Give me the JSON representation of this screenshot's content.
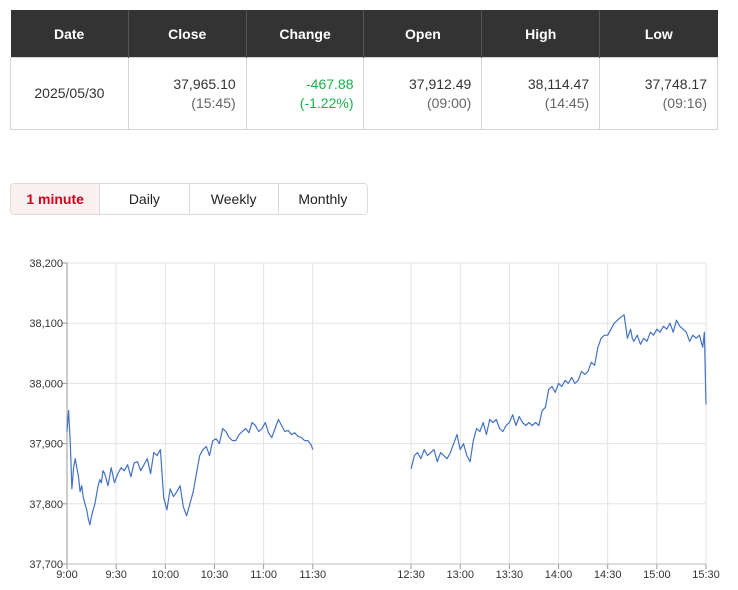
{
  "quote": {
    "headers": {
      "date": "Date",
      "close": "Close",
      "change": "Change",
      "open": "Open",
      "high": "High",
      "low": "Low"
    },
    "date": "2025/05/30",
    "close": {
      "value": "37,965.10",
      "time": "(15:45)"
    },
    "change": {
      "value": "-467.88",
      "percent": "(-1.22%)"
    },
    "open": {
      "value": "37,912.49",
      "time": "(09:00)"
    },
    "high": {
      "value": "38,114.47",
      "time": "(14:45)"
    },
    "low": {
      "value": "37,748.17",
      "time": "(09:16)"
    }
  },
  "tabs": [
    {
      "label": "1 minute",
      "active": true
    },
    {
      "label": "Daily",
      "active": false
    },
    {
      "label": "Weekly",
      "active": false
    },
    {
      "label": "Monthly",
      "active": false
    }
  ],
  "colors": {
    "line": "#4472c4",
    "negative": "#17b24a",
    "active_tab": "#d0021b",
    "header_bg": "#333333"
  },
  "chart_data": {
    "type": "line",
    "title": "",
    "xlabel": "",
    "ylabel": "",
    "grid": true,
    "xlim": [
      "09:00",
      "15:30"
    ],
    "ylim": [
      37700,
      38200
    ],
    "x_ticks": [
      "9:00",
      "9:30",
      "10:00",
      "10:30",
      "11:00",
      "11:30",
      "12:30",
      "13:00",
      "13:30",
      "14:00",
      "14:30",
      "15:00",
      "15:30"
    ],
    "y_ticks": [
      "37,700",
      "37,800",
      "37,900",
      "38,000",
      "38,100",
      "38,200"
    ],
    "series": [
      {
        "segments": [
          {
            "x": [
              "09:00",
              "09:01",
              "09:02",
              "09:03",
              "09:04",
              "09:05",
              "09:06",
              "09:07",
              "09:08",
              "09:09",
              "09:10",
              "09:11",
              "09:12",
              "09:13",
              "09:14",
              "09:15",
              "09:16",
              "09:17",
              "09:18",
              "09:19",
              "09:20",
              "09:21",
              "09:22",
              "09:23",
              "09:25",
              "09:27",
              "09:29",
              "09:31",
              "09:33",
              "09:35",
              "09:37",
              "09:39",
              "09:41",
              "09:43",
              "09:45",
              "09:47",
              "09:49",
              "09:51",
              "09:53",
              "09:55",
              "09:57",
              "09:59",
              "10:01",
              "10:03",
              "10:05",
              "10:07",
              "10:09",
              "10:11",
              "10:13",
              "10:15",
              "10:17",
              "10:19",
              "10:21",
              "10:23",
              "10:25",
              "10:27",
              "10:29",
              "10:31",
              "10:33",
              "10:35",
              "10:37",
              "10:39",
              "10:41",
              "10:43",
              "10:45",
              "10:47",
              "10:49",
              "10:51",
              "10:53",
              "10:55",
              "10:57",
              "10:59",
              "11:01",
              "11:03",
              "11:05",
              "11:07",
              "11:09",
              "11:11",
              "11:13",
              "11:15",
              "11:17",
              "11:19",
              "11:21",
              "11:23",
              "11:25",
              "11:27",
              "11:29",
              "11:30"
            ],
            "y": [
              37920,
              37955,
              37900,
              37825,
              37860,
              37875,
              37860,
              37845,
              37820,
              37830,
              37810,
              37800,
              37790,
              37775,
              37765,
              37780,
              37790,
              37800,
              37815,
              37830,
              37840,
              37835,
              37855,
              37850,
              37830,
              37860,
              37835,
              37850,
              37860,
              37855,
              37865,
              37845,
              37868,
              37870,
              37855,
              37865,
              37875,
              37850,
              37885,
              37880,
              37890,
              37810,
              37790,
              37825,
              37812,
              37820,
              37830,
              37795,
              37780,
              37800,
              37820,
              37850,
              37880,
              37890,
              37895,
              37880,
              37905,
              37908,
              37900,
              37925,
              37920,
              37910,
              37905,
              37905,
              37915,
              37920,
              37925,
              37918,
              37935,
              37930,
              37920,
              37925,
              37935,
              37918,
              37910,
              37925,
              37940,
              37930,
              37920,
              37922,
              37915,
              37918,
              37912,
              37910,
              37905,
              37905,
              37898,
              37890
            ]
          },
          {
            "x": [
              "12:30",
              "12:32",
              "12:34",
              "12:36",
              "12:38",
              "12:40",
              "12:42",
              "12:44",
              "12:46",
              "12:48",
              "12:50",
              "12:52",
              "12:54",
              "12:56",
              "12:58",
              "13:00",
              "13:02",
              "13:04",
              "13:06",
              "13:08",
              "13:10",
              "13:12",
              "13:14",
              "13:16",
              "13:18",
              "13:20",
              "13:22",
              "13:24",
              "13:26",
              "13:28",
              "13:30",
              "13:32",
              "13:34",
              "13:36",
              "13:38",
              "13:40",
              "13:42",
              "13:44",
              "13:46",
              "13:48",
              "13:50",
              "13:52",
              "13:54",
              "13:56",
              "13:58",
              "14:00",
              "14:02",
              "14:04",
              "14:06",
              "14:08",
              "14:10",
              "14:12",
              "14:14",
              "14:16",
              "14:18",
              "14:20",
              "14:22",
              "14:24",
              "14:26",
              "14:28",
              "14:30",
              "14:32",
              "14:34",
              "14:36",
              "14:38",
              "14:40",
              "14:42",
              "14:44",
              "14:45",
              "14:46",
              "14:48",
              "14:50",
              "14:52",
              "14:54",
              "14:56",
              "14:58",
              "15:00",
              "15:02",
              "15:04",
              "15:06",
              "15:08",
              "15:10",
              "15:12",
              "15:14",
              "15:16",
              "15:18",
              "15:20",
              "15:22",
              "15:24",
              "15:26",
              "15:28",
              "15:29",
              "15:30"
            ],
            "y": [
              37858,
              37880,
              37885,
              37875,
              37890,
              37880,
              37885,
              37890,
              37870,
              37885,
              37880,
              37875,
              37885,
              37900,
              37915,
              37890,
              37900,
              37880,
              37870,
              37905,
              37925,
              37920,
              37935,
              37915,
              37940,
              37935,
              37940,
              37925,
              37920,
              37930,
              37935,
              37948,
              37930,
              37945,
              37935,
              37930,
              37935,
              37930,
              37935,
              37930,
              37955,
              37960,
              37990,
              37995,
              37985,
              38000,
              37995,
              38005,
              38000,
              38010,
              38000,
              38005,
              38020,
              38015,
              38020,
              38035,
              38030,
              38060,
              38075,
              38080,
              38080,
              38090,
              38100,
              38105,
              38110,
              38114,
              38075,
              38090,
              38075,
              38070,
              38080,
              38065,
              38075,
              38070,
              38085,
              38080,
              38090,
              38085,
              38095,
              38090,
              38100,
              38085,
              38105,
              38095,
              38090,
              38085,
              38070,
              38080,
              38075,
              38080,
              38060,
              38085,
              37965
            ]
          }
        ]
      }
    ]
  }
}
